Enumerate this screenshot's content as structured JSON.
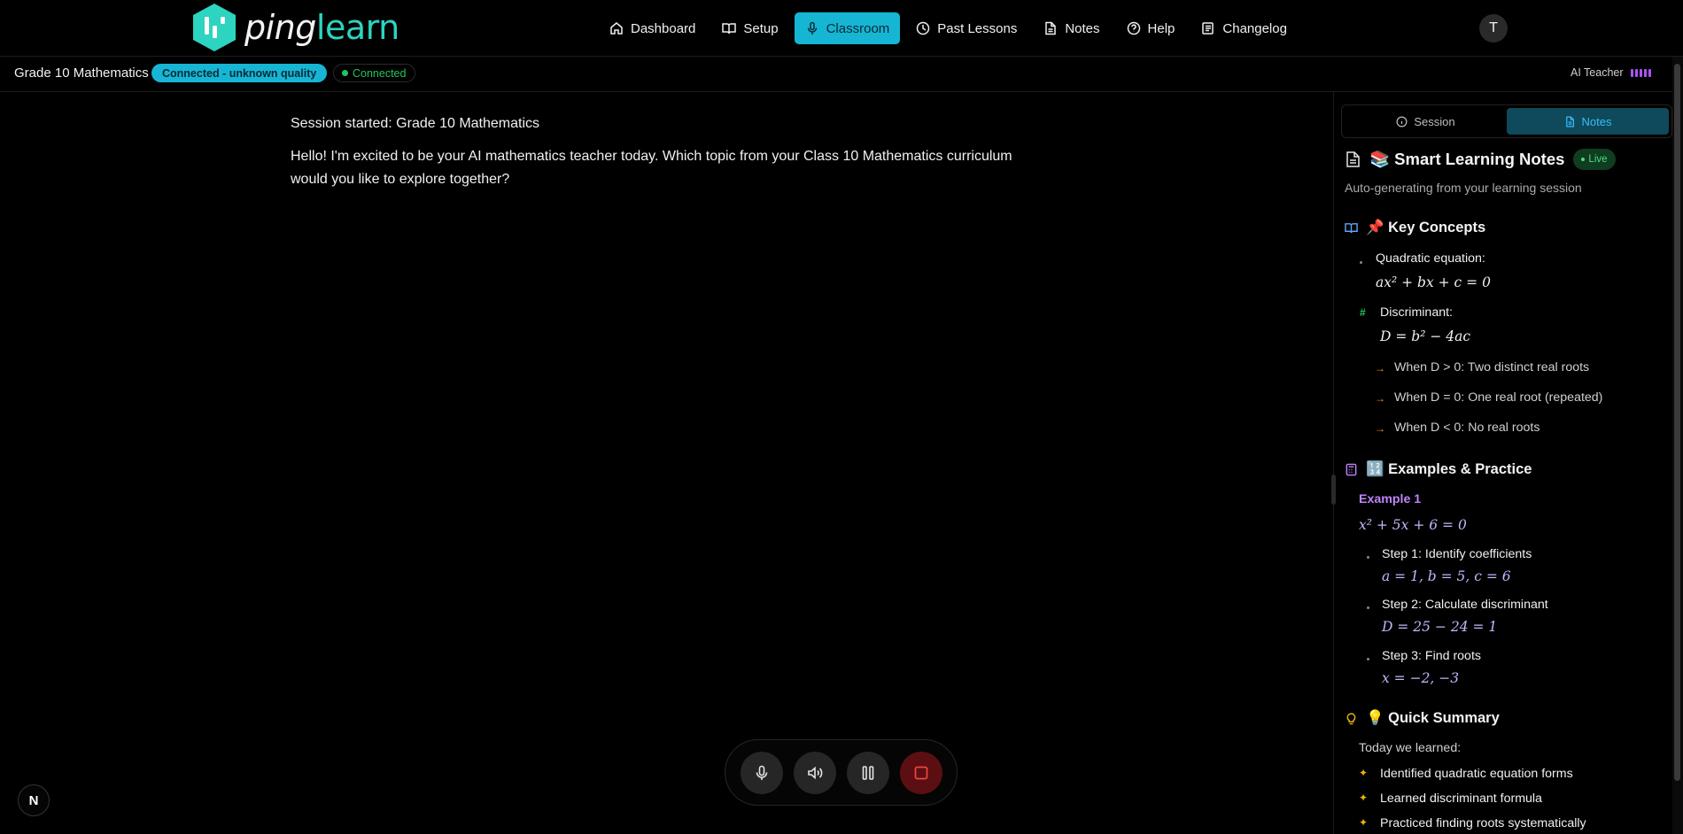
{
  "brand": {
    "name_a": "ping",
    "name_b": "learn",
    "hex_color": "#2dd4bf"
  },
  "nav": {
    "items": [
      {
        "label": "Dashboard",
        "icon": "home-icon"
      },
      {
        "label": "Setup",
        "icon": "book-icon"
      },
      {
        "label": "Classroom",
        "icon": "mic-icon",
        "active": true
      },
      {
        "label": "Past Lessons",
        "icon": "clock-icon"
      },
      {
        "label": "Notes",
        "icon": "file-icon"
      },
      {
        "label": "Help",
        "icon": "help-icon"
      },
      {
        "label": "Changelog",
        "icon": "changelog-icon"
      }
    ],
    "avatar_initial": "T"
  },
  "session_bar": {
    "course": "Grade 10 Mathematics",
    "quality_badge": "Connected - unknown quality",
    "connection_badge": "Connected",
    "ai_label": "AI Teacher"
  },
  "transcript": {
    "system_message": "Session started: Grade 10 Mathematics",
    "ai_message": "Hello! I'm excited to be your AI mathematics teacher today. Which topic from your Class 10 Mathematics curriculum would you like to explore together?"
  },
  "panel": {
    "tabs": [
      {
        "label": "Session",
        "icon": "info-icon"
      },
      {
        "label": "Notes",
        "icon": "file-icon",
        "active": true
      }
    ],
    "notes_title": "📚 Smart Learning Notes",
    "live_label": "Live",
    "subtitle": "Auto-generating from your learning session",
    "key_concepts": {
      "title": "📌 Key Concepts",
      "quadratic_label": "Quadratic equation:",
      "quadratic_formula": "ax² + bx + c = 0",
      "discriminant_label": "Discriminant:",
      "discriminant_formula": "D = b² − 4ac",
      "cases": [
        "When D > 0: Two distinct real roots",
        "When D = 0: One real root (repeated)",
        "When D < 0: No real roots"
      ]
    },
    "examples": {
      "title": "🔢 Examples & Practice",
      "example_label": "Example 1",
      "equation": "x² + 5x + 6 = 0",
      "steps": [
        {
          "label": "Step 1: Identify coefficients",
          "math": "a = 1, b = 5, c = 6"
        },
        {
          "label": "Step 2: Calculate discriminant",
          "math": "D = 25 − 24 = 1"
        },
        {
          "label": "Step 3: Find roots",
          "math": "x = −2, −3"
        }
      ]
    },
    "summary": {
      "title": "💡 Quick Summary",
      "intro": "Today we learned:",
      "items": [
        "Identified quadratic equation forms",
        "Learned discriminant formula",
        "Practiced finding roots systematically"
      ]
    }
  },
  "corner_badge": "N"
}
